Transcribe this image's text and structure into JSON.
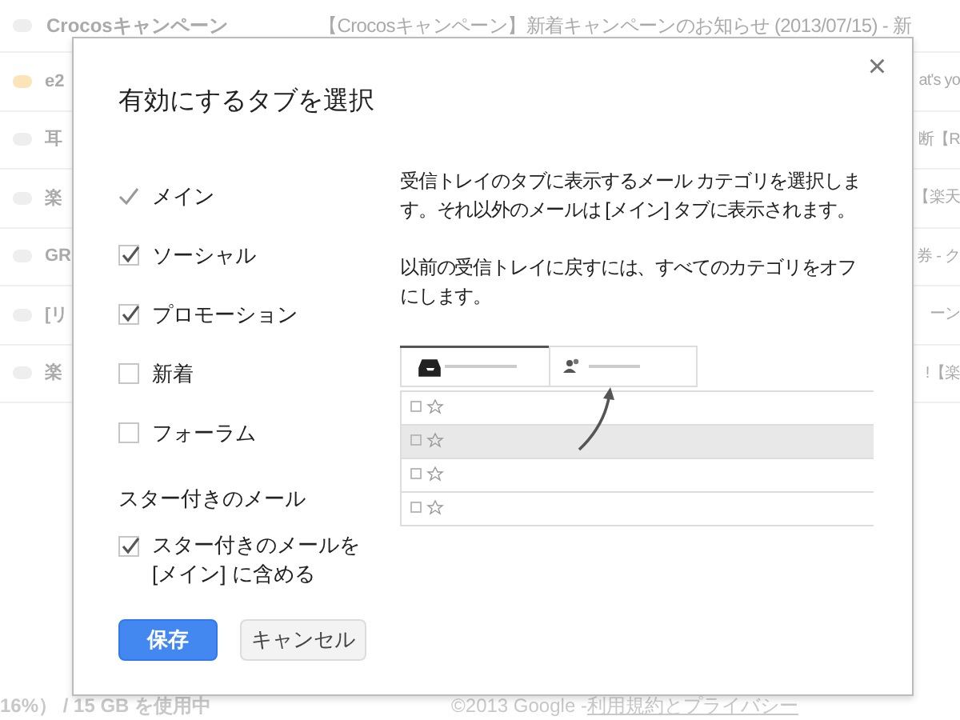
{
  "background_rows": [
    {
      "important": false,
      "sender": "Crocosキャンペーン",
      "subject": "【Crocosキャンペーン】新着キャンペーンのお知らせ (2013/07/15) - 新"
    },
    {
      "important": true,
      "sender": "e2",
      "subject": "at's yo"
    },
    {
      "important": false,
      "sender": "耳",
      "subject": "断【R"
    },
    {
      "important": false,
      "sender": "楽",
      "subject": "【楽天"
    },
    {
      "important": false,
      "sender": "GR",
      "subject": "券 - ク"
    },
    {
      "important": false,
      "sender": "[リ",
      "subject": "ーン"
    },
    {
      "important": false,
      "sender": "楽",
      "subject": "!【楽"
    }
  ],
  "footer": {
    "storage": "16%） / 15 GB を使用中",
    "copyright": "©2013 Google - ",
    "links": "利用規約とプライバシー"
  },
  "dialog": {
    "title": "有効にするタブを選択",
    "close": "×",
    "tabs": [
      {
        "kind": "fixed",
        "label": "メイン",
        "checked": true
      },
      {
        "kind": "checkbox",
        "label": "ソーシャル",
        "checked": true
      },
      {
        "kind": "checkbox",
        "label": "プロモーション",
        "checked": true
      },
      {
        "kind": "checkbox",
        "label": "新着",
        "checked": false
      },
      {
        "kind": "checkbox",
        "label": "フォーラム",
        "checked": false
      }
    ],
    "starred_heading": "スター付きのメール",
    "starred_option": {
      "label_lines": [
        "スター付きのメールを",
        "[メイン] に含める"
      ],
      "checked": true
    },
    "description": [
      "受信トレイのタブに表示するメール カテゴリを選択します。それ以外のメールは [メイン] タブに表示されます。",
      "以前の受信トレイに戻すには、すべてのカテゴリをオフにします。"
    ],
    "buttons": [
      {
        "kind": "primary",
        "label": "保存"
      },
      {
        "kind": "secondary",
        "label": "キャンセル"
      }
    ]
  }
}
